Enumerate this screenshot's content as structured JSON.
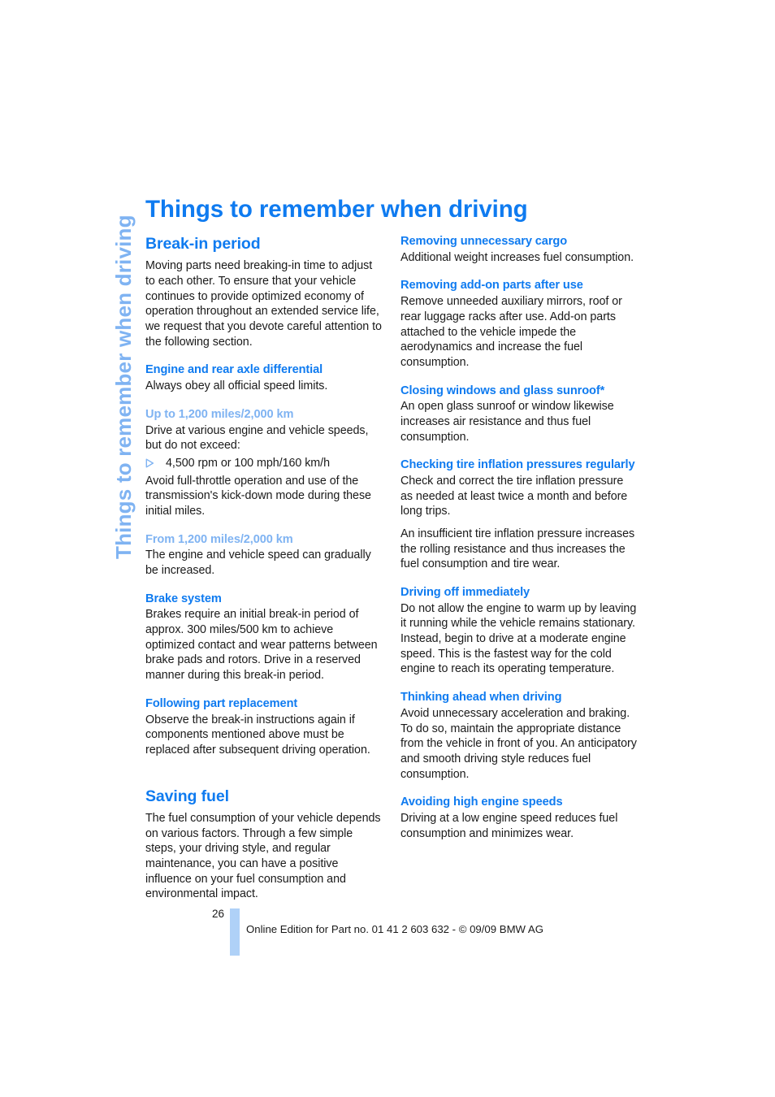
{
  "document": {
    "running_head": "Things to remember when driving",
    "title": "Things to remember when driving",
    "colors": {
      "heading_blue": "#0F7BF0",
      "light_blue": "#7FB3F2",
      "folio_bar_blue": "#AFD1F7",
      "body_text": "#1a1a1a",
      "background": "#ffffff"
    }
  },
  "left_column": {
    "section_break_in": {
      "heading": "Break-in period",
      "intro": "Moving parts need breaking-in time to adjust to each other. To ensure that your vehicle continues to provide optimized economy of operation throughout an extended service life, we request that you devote careful attention to the following section.",
      "sub_engine": {
        "heading": "Engine and rear axle differential",
        "body": "Always obey all official speed limits."
      },
      "sub_up_to": {
        "heading": "Up to 1,200 miles/2,000 km",
        "body": "Drive at various engine and vehicle speeds, but do not exceed:",
        "bullet": "4,500 rpm or 100 mph/160 km/h",
        "after_bullet": "Avoid full-throttle operation and use of the transmission's kick-down mode during these initial miles."
      },
      "sub_from": {
        "heading": "From 1,200 miles/2,000 km",
        "body": "The engine and vehicle speed can gradually be increased."
      },
      "sub_brake": {
        "heading": "Brake system",
        "body": "Brakes require an initial break-in period of approx. 300 miles/500 km to achieve optimized contact and wear patterns between brake pads and rotors. Drive in a reserved manner during this break-in period."
      },
      "sub_following": {
        "heading": "Following part replacement",
        "body": "Observe the break-in instructions again if components mentioned above must be replaced after subsequent driving operation."
      }
    },
    "section_saving_fuel": {
      "heading": "Saving fuel",
      "intro": "The fuel consumption of your vehicle depends on various factors. Through a few simple steps, your driving style, and regular maintenance, you can have a positive influence on your fuel consumption and environmental impact."
    }
  },
  "right_column": {
    "sub_cargo": {
      "heading": "Removing unnecessary cargo",
      "body": "Additional weight increases fuel consumption."
    },
    "sub_addon": {
      "heading": "Removing add-on parts after use",
      "body": "Remove unneeded auxiliary mirrors, roof or rear luggage racks after use. Add-on parts attached to the vehicle impede the aerodynamics and increase the fuel consumption."
    },
    "sub_windows": {
      "heading": "Closing windows and glass sunroof*",
      "body": "An open glass sunroof or window likewise increases air resistance and thus fuel consumption."
    },
    "sub_tires": {
      "heading": "Checking tire inflation pressures regularly",
      "body1": "Check and correct the tire inflation pressure as needed at least twice a month and before long trips.",
      "body2": "An insufficient tire inflation pressure increases the rolling resistance and thus increases the fuel consumption and tire wear."
    },
    "sub_driving_off": {
      "heading": "Driving off immediately",
      "body": "Do not allow the engine to warm up by leaving it running while the vehicle remains stationary. Instead, begin to drive at a moderate engine speed. This is the fastest way for the cold engine to reach its operating temperature."
    },
    "sub_thinking": {
      "heading": "Thinking ahead when driving",
      "body": "Avoid unnecessary acceleration and braking. To do so, maintain the appropriate distance from the vehicle in front of you. An anticipatory and smooth driving style reduces fuel consumption."
    },
    "sub_high_speeds": {
      "heading": "Avoiding high engine speeds",
      "body": "Driving at a low engine speed reduces fuel consumption and minimizes wear."
    }
  },
  "footer": {
    "page_number": "26",
    "imprint": "Online Edition for Part no. 01 41 2 603 632 - © 09/09 BMW AG"
  },
  "icons": {
    "bullet": "triangle-right-outline-icon"
  }
}
